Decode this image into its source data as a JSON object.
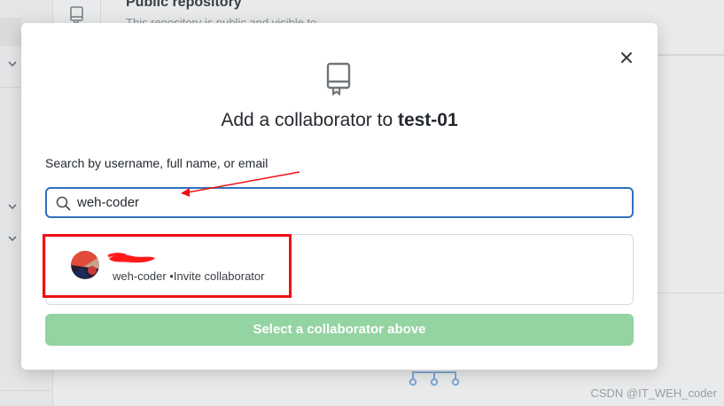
{
  "background": {
    "repo_title": "Public repository",
    "repo_subtitle": "This repository is public and visible to",
    "watermark": "CSDN @IT_WEH_coder"
  },
  "modal": {
    "title_prefix": "Add a collaborator to ",
    "repo_name": "test-01",
    "search_label": "Search by username, full name, or email",
    "search_value": "weh-coder",
    "results": [
      {
        "meta": "weh-coder •Invite collaborator"
      }
    ],
    "submit_label": "Select a collaborator above"
  },
  "colors": {
    "focus_border": "#2f6fbf",
    "button_disabled_green": "#94d3a2",
    "annotation_red": "#ee1111"
  },
  "icons": {
    "close": "close-icon",
    "repo": "repo-icon",
    "search": "search-icon"
  }
}
